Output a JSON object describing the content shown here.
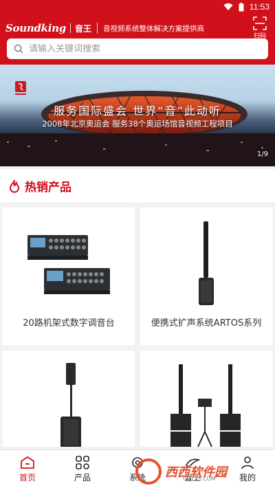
{
  "status_bar": {
    "time": "11:53"
  },
  "header": {
    "logo_word": "Soundking",
    "logo_cn": "音王",
    "slogan": "音视频系统整体解决方案提供商",
    "scan_label": "扫码"
  },
  "search": {
    "placeholder": "请输入关键词搜索"
  },
  "banner": {
    "title": "服务国际盛会 世界“音”此动听",
    "subtitle": "2008年北京奥运会 服务38个奥运场馆音视频工程项目",
    "counter": "1/9"
  },
  "section": {
    "title": "热销产品"
  },
  "products": [
    {
      "name": "20路机架式数字调音台",
      "image": "digital-mixer-image"
    },
    {
      "name": "便携式扩声系统ARTOS系列",
      "image": "column-speaker-image"
    },
    {
      "name": "",
      "image": "pa-speaker-stand-image"
    },
    {
      "name": "",
      "image": "line-array-system-image"
    }
  ],
  "nav": {
    "items": [
      {
        "label": "首页",
        "icon": "home-icon",
        "active": true
      },
      {
        "label": "产品",
        "icon": "products-icon",
        "active": false
      },
      {
        "label": "系统",
        "icon": "system-icon",
        "active": false
      },
      {
        "label": "音王",
        "icon": "brand-icon",
        "active": false
      },
      {
        "label": "我的",
        "icon": "user-icon",
        "active": false
      }
    ]
  },
  "watermark": {
    "text": "西西软件园",
    "sub": "CR173.COM"
  },
  "colors": {
    "brand_red": "#d0101a"
  }
}
